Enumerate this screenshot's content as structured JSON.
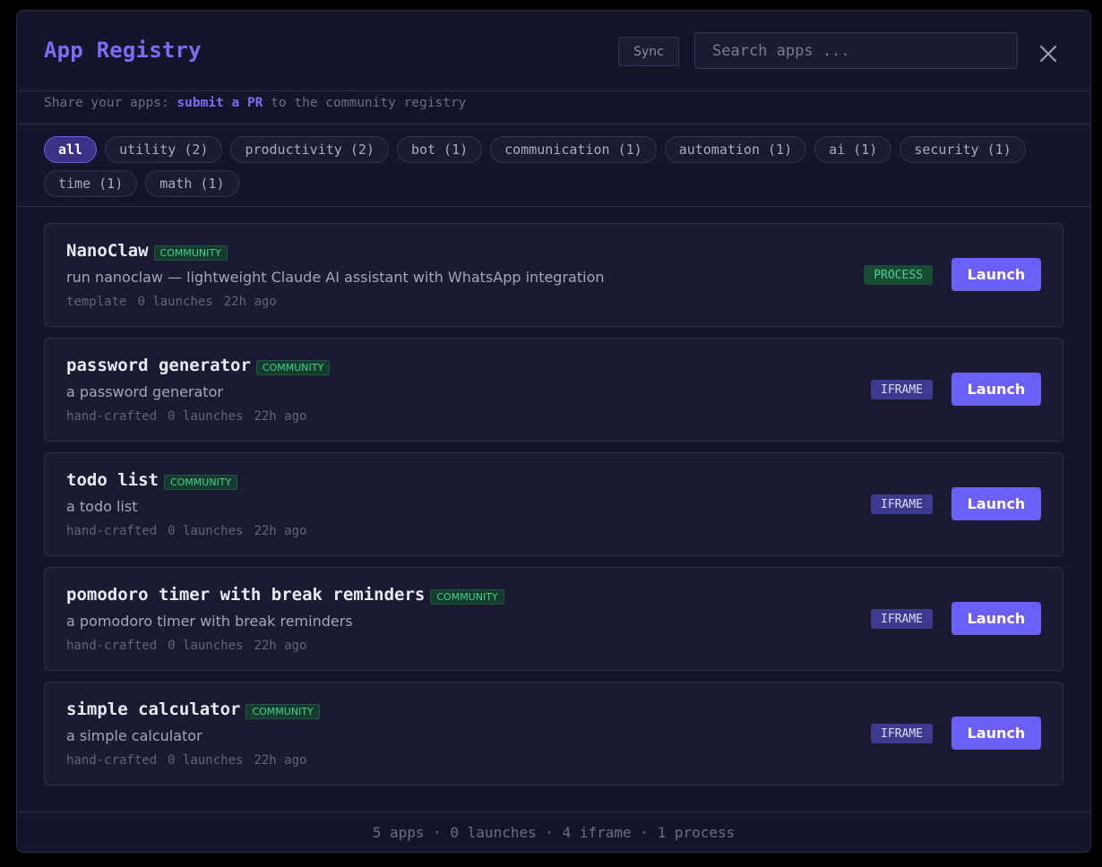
{
  "header": {
    "title": "App Registry",
    "sync_label": "Sync",
    "search_placeholder": "Search apps ..."
  },
  "share": {
    "prefix": "Share your apps: ",
    "link": "submit a PR",
    "suffix": " to the community registry"
  },
  "filters": [
    {
      "label": "all",
      "active": true
    },
    {
      "label": "utility (2)"
    },
    {
      "label": "productivity (2)"
    },
    {
      "label": "bot (1)"
    },
    {
      "label": "communication (1)"
    },
    {
      "label": "automation (1)"
    },
    {
      "label": "ai (1)"
    },
    {
      "label": "security (1)"
    },
    {
      "label": "time (1)"
    },
    {
      "label": "math (1)"
    }
  ],
  "apps": [
    {
      "name": "NanoClaw",
      "badge": "COMMUNITY",
      "description": "run nanoclaw — lightweight Claude AI assistant with WhatsApp integration",
      "source": "template",
      "launches": "0 launches",
      "age": "22h ago",
      "type": "PROCESS",
      "launch_label": "Launch"
    },
    {
      "name": "password generator",
      "badge": "COMMUNITY",
      "description": "a password generator",
      "source": "hand-crafted",
      "launches": "0 launches",
      "age": "22h ago",
      "type": "IFRAME",
      "launch_label": "Launch"
    },
    {
      "name": "todo list",
      "badge": "COMMUNITY",
      "description": "a todo list",
      "source": "hand-crafted",
      "launches": "0 launches",
      "age": "22h ago",
      "type": "IFRAME",
      "launch_label": "Launch"
    },
    {
      "name": "pomodoro timer with break reminders",
      "badge": "COMMUNITY",
      "description": "a pomodoro timer with break reminders",
      "source": "hand-crafted",
      "launches": "0 launches",
      "age": "22h ago",
      "type": "IFRAME",
      "launch_label": "Launch"
    },
    {
      "name": "simple calculator",
      "badge": "COMMUNITY",
      "description": "a simple calculator",
      "source": "hand-crafted",
      "launches": "0 launches",
      "age": "22h ago",
      "type": "IFRAME",
      "launch_label": "Launch"
    }
  ],
  "footer": {
    "summary": "5 apps · 0 launches · 4 iframe · 1 process"
  },
  "colors": {
    "accent": "#6c5ff5",
    "background": "#14142a",
    "community_badge": "#3ed38a",
    "iframe_badge": "#3e3a8f",
    "process_badge": "#174c35"
  },
  "icons": {
    "close": "close-icon"
  }
}
